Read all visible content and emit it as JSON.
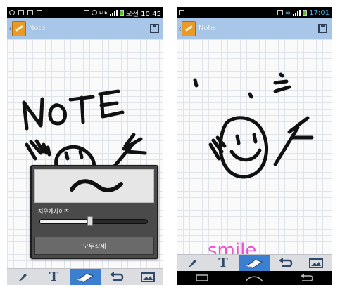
{
  "left_phone": {
    "statusbar": {
      "left_icons": [
        "g-icon",
        "usb-icon",
        "screen-icon",
        "image-icon"
      ],
      "network": "LTE",
      "time": "오전 10:45"
    },
    "titlebar": {
      "title": "Note"
    },
    "eraser_popup": {
      "size_label": "지우개사이즈",
      "size_value": 0.47,
      "clear_all_label": "모두삭제"
    },
    "toolbar": {
      "tools": [
        {
          "name": "pen-tool",
          "icon": "brush-icon",
          "active": false
        },
        {
          "name": "text-tool",
          "icon": "text-icon",
          "glyph": "T",
          "active": false
        },
        {
          "name": "eraser-tool",
          "icon": "eraser-icon",
          "active": true
        },
        {
          "name": "undo-tool",
          "icon": "undo-icon",
          "active": false
        },
        {
          "name": "image-tool",
          "icon": "image-icon",
          "active": false
        }
      ]
    }
  },
  "right_phone": {
    "statusbar": {
      "left_icons": [
        "image-icon"
      ],
      "time": "17:01"
    },
    "titlebar": {
      "title": "Note"
    },
    "canvas_text": "smile",
    "toolbar": {
      "tools": [
        {
          "name": "pen-tool",
          "icon": "brush-icon",
          "active": false
        },
        {
          "name": "text-tool",
          "icon": "text-icon",
          "glyph": "T",
          "active": false
        },
        {
          "name": "eraser-tool",
          "icon": "eraser-icon",
          "active": true
        },
        {
          "name": "undo-tool",
          "icon": "undo-icon",
          "active": false
        },
        {
          "name": "image-tool",
          "icon": "image-icon",
          "active": false
        }
      ]
    },
    "navbar": [
      "back-icon",
      "home-icon",
      "recent-apps-icon"
    ]
  },
  "colors": {
    "titlebar": "#a8c7e8",
    "active_tool": "#3b7fd1",
    "ink": "#111111",
    "smile_text": "#f04fd2"
  }
}
